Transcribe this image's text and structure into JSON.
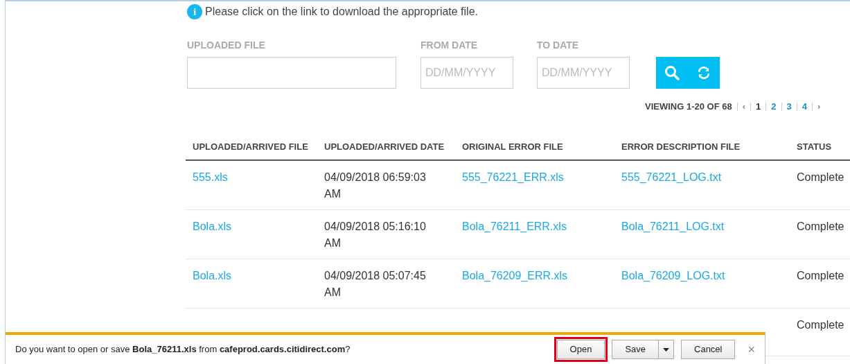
{
  "notice": {
    "icon": "i",
    "text": "Please click on the link to download the appropriate file."
  },
  "filters": [
    {
      "label": "UPLOADED FILE",
      "kind": "text"
    },
    {
      "label": "FROM DATE",
      "kind": "date",
      "placeholder": "DD/MM/YYYY"
    },
    {
      "label": "TO DATE",
      "kind": "date",
      "placeholder": "DD/MM/YYYY"
    }
  ],
  "pagination": {
    "summary": "VIEWING 1-20 OF 68",
    "prev": "‹",
    "next": "›",
    "pages": [
      {
        "label": "1",
        "selected": true
      },
      {
        "label": "2",
        "selected": false
      },
      {
        "label": "3",
        "selected": false
      },
      {
        "label": "4",
        "selected": false
      }
    ]
  },
  "table": {
    "columns": [
      "UPLOADED/ARRIVED FILE",
      "UPLOADED/ARRIVED DATE",
      "ORIGINAL ERROR FILE",
      "ERROR DESCRIPTION FILE",
      "STATUS"
    ],
    "rows": [
      {
        "file": "555.xls",
        "date": "04/09/2018 06:59:03 AM",
        "error_file": "555_76221_ERR.xls",
        "log_file": "555_76221_LOG.txt",
        "status": "Complete"
      },
      {
        "file": "Bola.xls",
        "date": "04/09/2018 05:16:10 AM",
        "error_file": "Bola_76211_ERR.xls",
        "log_file": "Bola_76211_LOG.txt",
        "status": "Complete"
      },
      {
        "file": "Bola.xls",
        "date": "04/09/2018 05:07:45 AM",
        "error_file": "Bola_76209_ERR.xls",
        "log_file": "Bola_76209_LOG.txt",
        "status": "Complete"
      },
      {
        "status": "Complete"
      }
    ]
  },
  "download_bar": {
    "message": "Do you want to open or save **Bola_76211.xls** from **cafeprod.cards.citidirect.com**?",
    "buttons": [
      {
        "label": "Open",
        "highlighted": true,
        "dropdown": false
      },
      {
        "label": "Save",
        "highlighted": false,
        "dropdown": true
      },
      {
        "label": "Cancel",
        "highlighted": false,
        "dropdown": false
      }
    ],
    "close": "×"
  }
}
